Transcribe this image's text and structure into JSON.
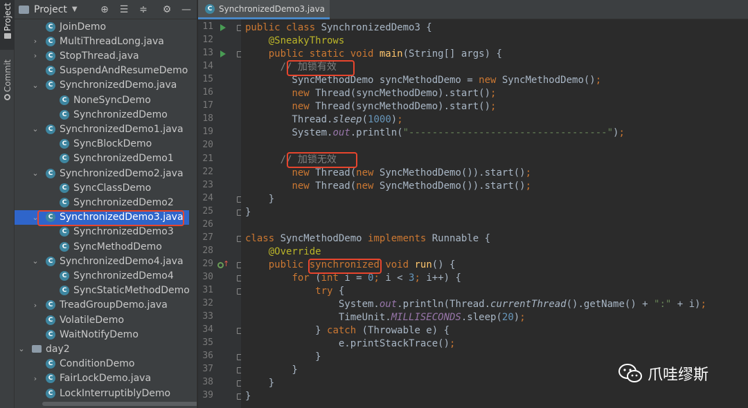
{
  "tool_strip": {
    "project_tab": "Project",
    "commit_tab": "Commit"
  },
  "project_panel": {
    "title": "Project",
    "tree": [
      {
        "label": "JoinDemo",
        "type": "class",
        "arrow": ""
      },
      {
        "label": "MultiThreadLong.java",
        "type": "class",
        "arrow": "›"
      },
      {
        "label": "StopThread.java",
        "type": "class",
        "arrow": "›"
      },
      {
        "label": "SuspendAndResumeDemo",
        "type": "class",
        "arrow": ""
      },
      {
        "label": "SynchronizedDemo.java",
        "type": "class",
        "arrow": "⌄"
      },
      {
        "label": "NoneSyncDemo",
        "type": "class",
        "arrow": ""
      },
      {
        "label": "SynchronizedDemo",
        "type": "class",
        "arrow": ""
      },
      {
        "label": "SynchronizedDemo1.java",
        "type": "class",
        "arrow": "⌄"
      },
      {
        "label": "SyncBlockDemo",
        "type": "class",
        "arrow": ""
      },
      {
        "label": "SynchronizedDemo1",
        "type": "class",
        "arrow": ""
      },
      {
        "label": "SynchronizedDemo2.java",
        "type": "class",
        "arrow": "⌄"
      },
      {
        "label": "SyncClassDemo",
        "type": "class",
        "arrow": ""
      },
      {
        "label": "SynchronizedDemo2",
        "type": "class",
        "arrow": ""
      },
      {
        "label": "SynchronizedDemo3.java",
        "type": "class",
        "arrow": "⌄",
        "selected": true
      },
      {
        "label": "SynchronizedDemo3",
        "type": "class",
        "arrow": ""
      },
      {
        "label": "SyncMethodDemo",
        "type": "class",
        "arrow": ""
      },
      {
        "label": "SynchronizedDemo4.java",
        "type": "class",
        "arrow": "⌄"
      },
      {
        "label": "SynchronizedDemo4",
        "type": "class",
        "arrow": ""
      },
      {
        "label": "SyncStaticMethodDemo",
        "type": "class",
        "arrow": ""
      },
      {
        "label": "TreadGroupDemo.java",
        "type": "class",
        "arrow": "›"
      },
      {
        "label": "VolatileDemo",
        "type": "class",
        "arrow": ""
      },
      {
        "label": "WaitNotifyDemo",
        "type": "class",
        "arrow": ""
      },
      {
        "label": "day2",
        "type": "folder",
        "arrow": "⌄"
      },
      {
        "label": "ConditionDemo",
        "type": "class",
        "arrow": ""
      },
      {
        "label": "FairLockDemo.java",
        "type": "class",
        "arrow": "›"
      },
      {
        "label": "LockInterruptiblyDemo",
        "type": "class",
        "arrow": ""
      }
    ]
  },
  "editor": {
    "tab_label": "SynchronizedDemo3.java",
    "line_numbers": [
      "11",
      "12",
      "13",
      "14",
      "15",
      "16",
      "17",
      "18",
      "19",
      "20",
      "21",
      "22",
      "23",
      "24",
      "25",
      "26",
      "27",
      "28",
      "29",
      "30",
      "31",
      "32",
      "33",
      "34",
      "35",
      "36",
      "37",
      "38",
      "39"
    ],
    "lines": [
      "[[k:public class ]]SynchronizedDemo3 {",
      "    [[a:@SneakyThrows]]",
      "    [[k:public static void ]][[f:main]](String[] args) {",
      "      [[c:// 加锁有效]]",
      "        SyncMethodDemo syncMethodDemo = [[k:new ]]SyncMethodDemo()[[k:;]]",
      "        [[k:new ]]Thread(syncMethodDemo).start()[[k:;]]",
      "        [[k:new ]]Thread(syncMethodDemo).start()[[k:;]]",
      "        Thread.[[it:sleep]]([[n:1000]])[[k:;]]",
      "        System.[[st:out]].println([[s:\"----------------------------------\"]])[[k:;]]",
      "",
      "      [[c:// 加锁无效]]",
      "        [[k:new ]]Thread([[k:new ]]SyncMethodDemo()).start()[[k:;]]",
      "        [[k:new ]]Thread([[k:new ]]SyncMethodDemo()).start()[[k:;]]",
      "    }",
      "}",
      "",
      "[[k:class ]]SyncMethodDemo [[k:implements ]]Runnable {",
      "    [[a:@Override]]",
      "    [[k:public ]][[k:synchronized ]][[k:void ]][[f:run]]() {",
      "        [[k:for ]]([[k:int ]]i = [[n:0]][[k:; ]]i < [[n:3]][[k:; ]]i++) {",
      "            [[k:try ]]{",
      "                System.[[st:out]].println(Thread.[[it:currentThread]]().getName() + [[s:\":\"]] + i)[[k:;]]",
      "                TimeUnit.[[st:MILLISECONDS]].sleep([[n:20]])[[k:;]]",
      "            } [[k:catch ]](Throwable e) {",
      "                e.printStackTrace()[[k:;]]",
      "            }",
      "        }",
      "    }",
      "}"
    ]
  },
  "watermark": {
    "text": "爪哇缪斯",
    "icon": "wechat-icon"
  }
}
